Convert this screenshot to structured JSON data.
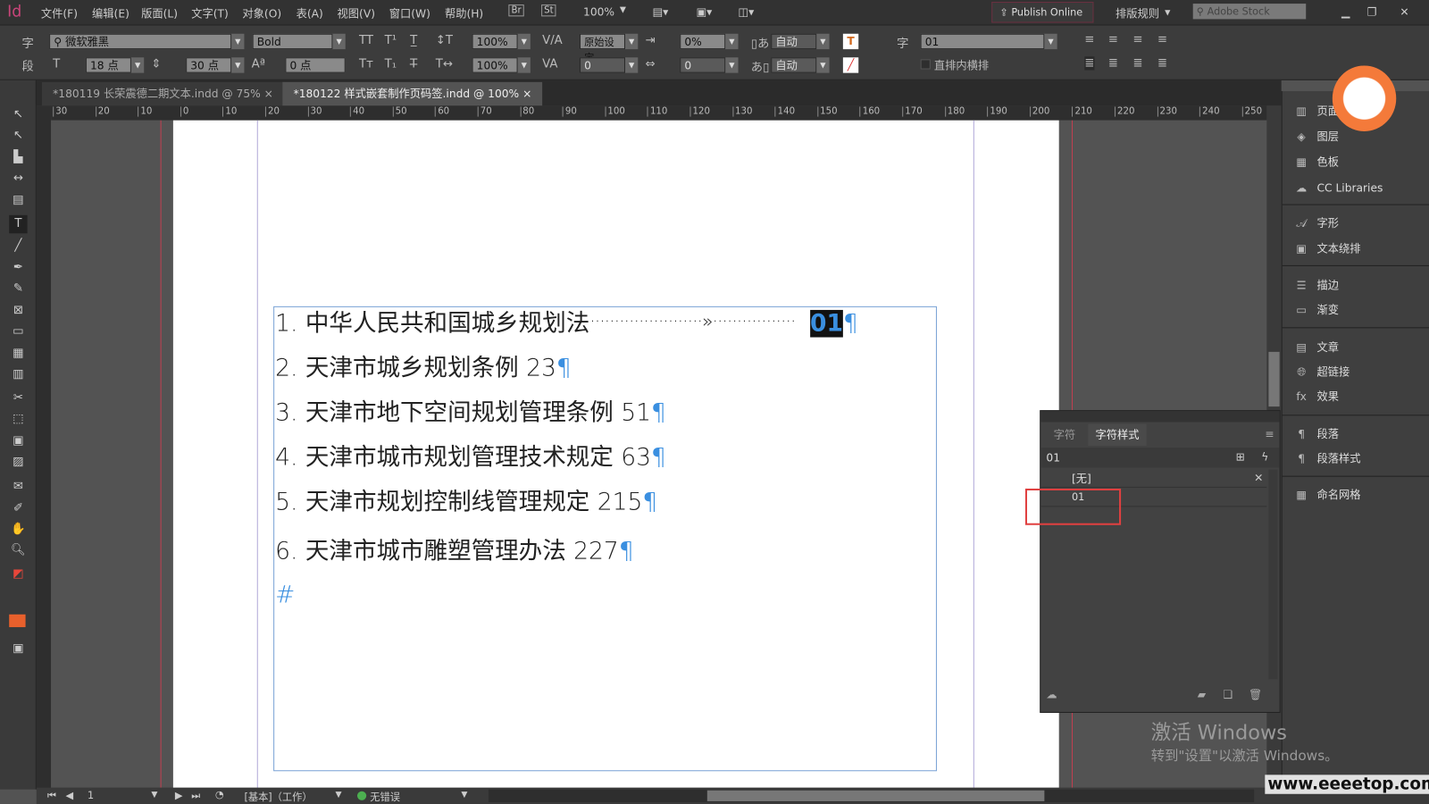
{
  "app": {
    "logo": "Id"
  },
  "menu": [
    "文件(F)",
    "编辑(E)",
    "版面(L)",
    "文字(T)",
    "对象(O)",
    "表(A)",
    "视图(V)",
    "窗口(W)",
    "帮助(H)"
  ],
  "appbar": {
    "br": "Br",
    "st": "St",
    "zoom": "100%",
    "publish": "Publish Online",
    "workspace": "排版规则",
    "search_placeholder": "Adobe Stock"
  },
  "control": {
    "char_label": "字",
    "para_label": "段",
    "font": "微软雅黑",
    "style": "Bold",
    "size": "18 点",
    "leading": "30 点",
    "baseline": "0 点",
    "vscale": "100%",
    "hscale": "100%",
    "kerning": "原始设定",
    "tracking": "0",
    "tsume": "0%",
    "aki": "0",
    "auto1": "自动",
    "auto2": "自动",
    "char_style_label": "字",
    "char_style": "01",
    "tcy": "直排内横排"
  },
  "tabs": [
    {
      "label": "*180119 长荣震德二期文本.indd @ 75%",
      "active": false
    },
    {
      "label": "*180122 样式嵌套制作页码签.indd @ 100%",
      "active": true
    }
  ],
  "ruler_ticks": [
    "30",
    "20",
    "10",
    "0",
    "10",
    "20",
    "30",
    "40",
    "50",
    "60",
    "70",
    "80",
    "90",
    "100",
    "110",
    "120",
    "130",
    "140",
    "150",
    "160",
    "170",
    "180",
    "190",
    "200",
    "210",
    "220",
    "230",
    "240",
    "250"
  ],
  "document": {
    "lines": [
      {
        "text": "1. 中华人民共和国城乡规划法",
        "leader": "·······················»·················",
        "page": "01"
      },
      {
        "text": "2. 天津市城乡规划条例 23"
      },
      {
        "text": "3. 天津市地下空间规划管理条例 51"
      },
      {
        "text": "4. 天津市城市规划管理技术规定 63"
      },
      {
        "text": "5. 天津市规划控制线管理规定 215"
      },
      {
        "text": "6. 天津市城市雕塑管理办法 227"
      }
    ],
    "pilcrow": "¶",
    "end_mark": "#"
  },
  "panels": [
    {
      "label": "页面",
      "icon": "pages-icon"
    },
    {
      "label": "图层",
      "icon": "layers-icon"
    },
    {
      "label": "色板",
      "icon": "swatches-icon"
    },
    {
      "label": "CC Libraries",
      "icon": "cc-libraries-icon"
    },
    {
      "label": "字形",
      "icon": "glyphs-icon"
    },
    {
      "label": "文本绕排",
      "icon": "text-wrap-icon"
    },
    {
      "label": "描边",
      "icon": "stroke-icon"
    },
    {
      "label": "渐变",
      "icon": "gradient-icon"
    },
    {
      "label": "文章",
      "icon": "story-icon"
    },
    {
      "label": "超链接",
      "icon": "hyperlinks-icon"
    },
    {
      "label": "效果",
      "icon": "effects-icon"
    },
    {
      "label": "段落",
      "icon": "paragraph-icon"
    },
    {
      "label": "段落样式",
      "icon": "paragraph-styles-icon"
    },
    {
      "label": "命名网格",
      "icon": "named-grids-icon"
    }
  ],
  "char_styles_panel": {
    "tab_char": "字符",
    "tab_styles": "字符样式",
    "current": "01",
    "items": [
      "[无]",
      "01"
    ]
  },
  "status": {
    "page": "1",
    "master": "[基本]（工作）",
    "preflight": "无错误"
  },
  "watermark": {
    "title": "激活 Windows",
    "sub": "转到\"设置\"以激活 Windows。",
    "site": "www.eeeetop.com"
  },
  "colors": {
    "accent": "#3a8fe0",
    "highlight": "#e8463a",
    "preflight_ok": "#4caf50"
  }
}
